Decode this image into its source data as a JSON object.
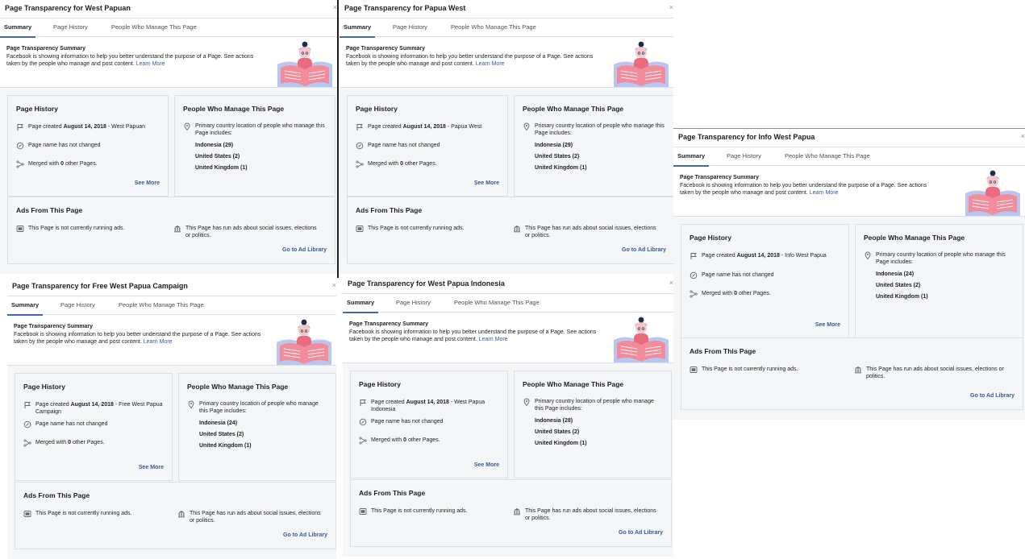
{
  "common": {
    "tabs": [
      "Summary",
      "Page History",
      "People Who Manage This Page"
    ],
    "close_glyph": "×",
    "summary_title": "Page Transparency Summary",
    "summary_desc": "Facebook is showing information to help you better understand the purpose of a Page. See actions taken by the people who manage and post content.",
    "learn_more": "Learn More",
    "history_title": "Page History",
    "page_created_prefix": "Page created",
    "created_date": "August 14, 2018",
    "name_not_changed": "Page name has not changed",
    "merged_prefix": "Merged with",
    "merged_count": "0",
    "merged_suffix": "other Pages.",
    "see_more": "See More",
    "people_title": "People Who Manage This Page",
    "people_desc": "Primary country location of people who manage this Page includes:",
    "ads_title": "Ads From This Page",
    "ads_not_running": "This Page is not currently running ads.",
    "ads_social": "This Page has run ads about social issues, elections or politics.",
    "ad_library": "Go to Ad Library",
    "icons": [
      "flag-icon",
      "edit-circle-icon",
      "merge-icon",
      "location-pin-icon",
      "ad-screen-icon",
      "bank-icon",
      "close-icon"
    ],
    "colors": {
      "link": "#385898",
      "tab_underline": "#4267b2",
      "gray_bg": "#f5f6f7",
      "border": "#dddfe2"
    }
  },
  "panels": [
    {
      "title": "Page Transparency for West Papuan",
      "page_name": "West Papuan",
      "countries": [
        "Indonesia (29)",
        "United States (2)",
        "United Kingdom (1)"
      ]
    },
    {
      "title": "Page Transparency for Papua West",
      "page_name": "Papua West",
      "countries": [
        "Indonesia (29)",
        "United States (2)",
        "United Kingdom (1)"
      ]
    },
    {
      "title": "Page Transparency for Info West Papua",
      "page_name": "Info West Papua",
      "countries": [
        "Indonesia (24)",
        "United States (2)",
        "United Kingdom (1)"
      ]
    },
    {
      "title": "Page Transparency for Free West Papua Campaign",
      "page_name": "Free West Papua Campaign",
      "countries": [
        "Indonesia (24)",
        "United States (2)",
        "United Kingdom (1)"
      ]
    },
    {
      "title": "Page Transparency for West Papua Indonesia",
      "page_name": "West Papua Indonesia",
      "countries": [
        "Indonesia (28)",
        "United States (2)",
        "United Kingdom (1)"
      ]
    }
  ]
}
